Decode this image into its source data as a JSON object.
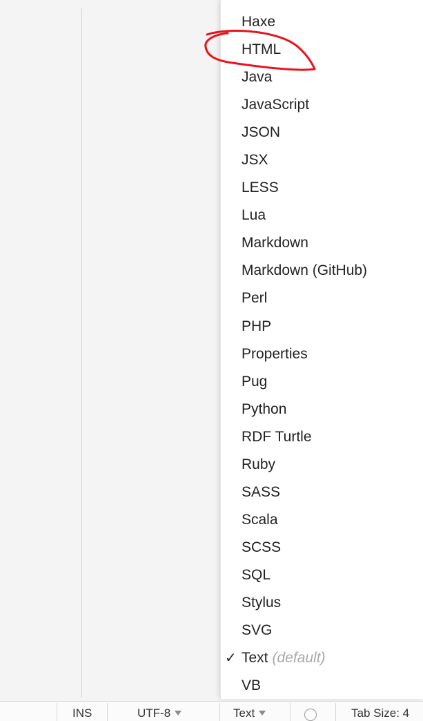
{
  "language_menu": {
    "items": [
      {
        "label": "Haxe"
      },
      {
        "label": "HTML"
      },
      {
        "label": "Java"
      },
      {
        "label": "JavaScript"
      },
      {
        "label": "JSON"
      },
      {
        "label": "JSX"
      },
      {
        "label": "LESS"
      },
      {
        "label": "Lua"
      },
      {
        "label": "Markdown"
      },
      {
        "label": "Markdown (GitHub)"
      },
      {
        "label": "Perl"
      },
      {
        "label": "PHP"
      },
      {
        "label": "Properties"
      },
      {
        "label": "Pug"
      },
      {
        "label": "Python"
      },
      {
        "label": "RDF Turtle"
      },
      {
        "label": "Ruby"
      },
      {
        "label": "SASS"
      },
      {
        "label": "Scala"
      },
      {
        "label": "SCSS"
      },
      {
        "label": "SQL"
      },
      {
        "label": "Stylus"
      },
      {
        "label": "SVG"
      },
      {
        "label": "Text",
        "note": "(default)",
        "checked": true,
        "checkmark": "✓"
      },
      {
        "label": "VB"
      }
    ],
    "highlight_color": "#e8131c"
  },
  "status_bar": {
    "ins_label": "INS",
    "encoding_label": "UTF-8",
    "language_label": "Text",
    "tab_size_label": "Tab Size: 4"
  }
}
